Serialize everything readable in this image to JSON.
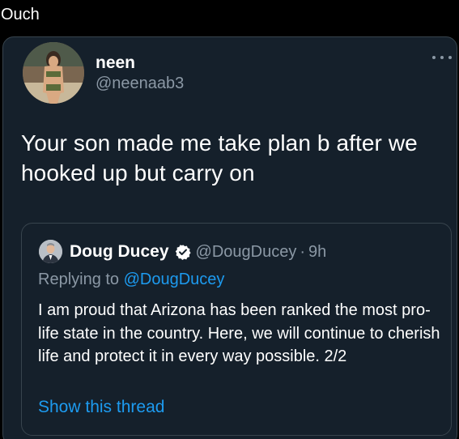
{
  "caption": "Ouch",
  "tweet": {
    "author_name": "neen",
    "author_handle": "@neenaab3",
    "text": "Your son made me take plan b after we hooked up but carry on",
    "more_icon": "more-horizontal-icon"
  },
  "quoted_tweet": {
    "author_name": "Doug Ducey",
    "verified_icon": "verified-badge-icon",
    "author_handle": "@DougDucey",
    "separator": "·",
    "time": "9h",
    "replying_prefix": "Replying to",
    "replying_to": "@DougDucey",
    "text": "I am proud that Arizona has been ranked the most pro-life state in the country. Here, we will continue to cherish life and protect it in every way possible. 2/2",
    "show_thread": "Show this thread"
  },
  "colors": {
    "background": "#000000",
    "card_background": "#15202b",
    "border": "#38444d",
    "secondary_text": "#8b98a5",
    "link": "#1d9bf0",
    "primary_text": "#ffffff"
  }
}
